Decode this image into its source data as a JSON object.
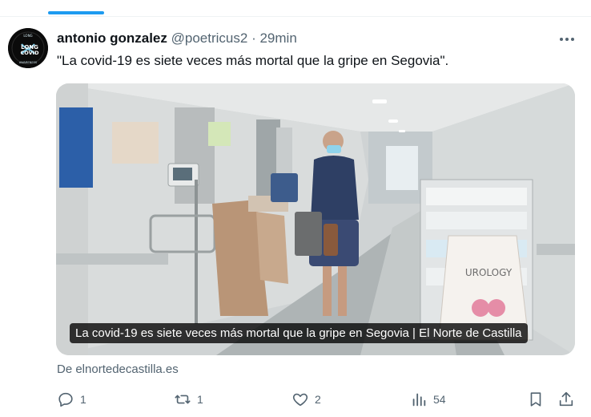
{
  "tweet": {
    "display_name": "antonio gonzalez",
    "handle": "@poetricus2",
    "separator": "·",
    "time": "29min",
    "text": "\"La covid-19 es siete veces más mortal que la gripe en Segovia\".",
    "avatar": {
      "top_text": "LONG",
      "main_text": "LONG",
      "sub_text": "COVID",
      "ring_text": "AWARENESS"
    }
  },
  "card": {
    "caption": "La covid-19 es siete veces más mortal que la gripe en Segovia | El Norte de Castilla",
    "bag_text": "UROLOGY",
    "source": "De elnortedecastilla.es"
  },
  "actions": {
    "replies": "1",
    "retweets": "1",
    "likes": "2",
    "views": "54"
  },
  "icons": [
    "more-icon",
    "reply-icon",
    "retweet-icon",
    "like-icon",
    "views-icon",
    "bookmark-icon",
    "share-icon"
  ],
  "colors": {
    "accent": "#1d9bf0",
    "secondary_text": "#536471",
    "primary_text": "#0f1419"
  }
}
